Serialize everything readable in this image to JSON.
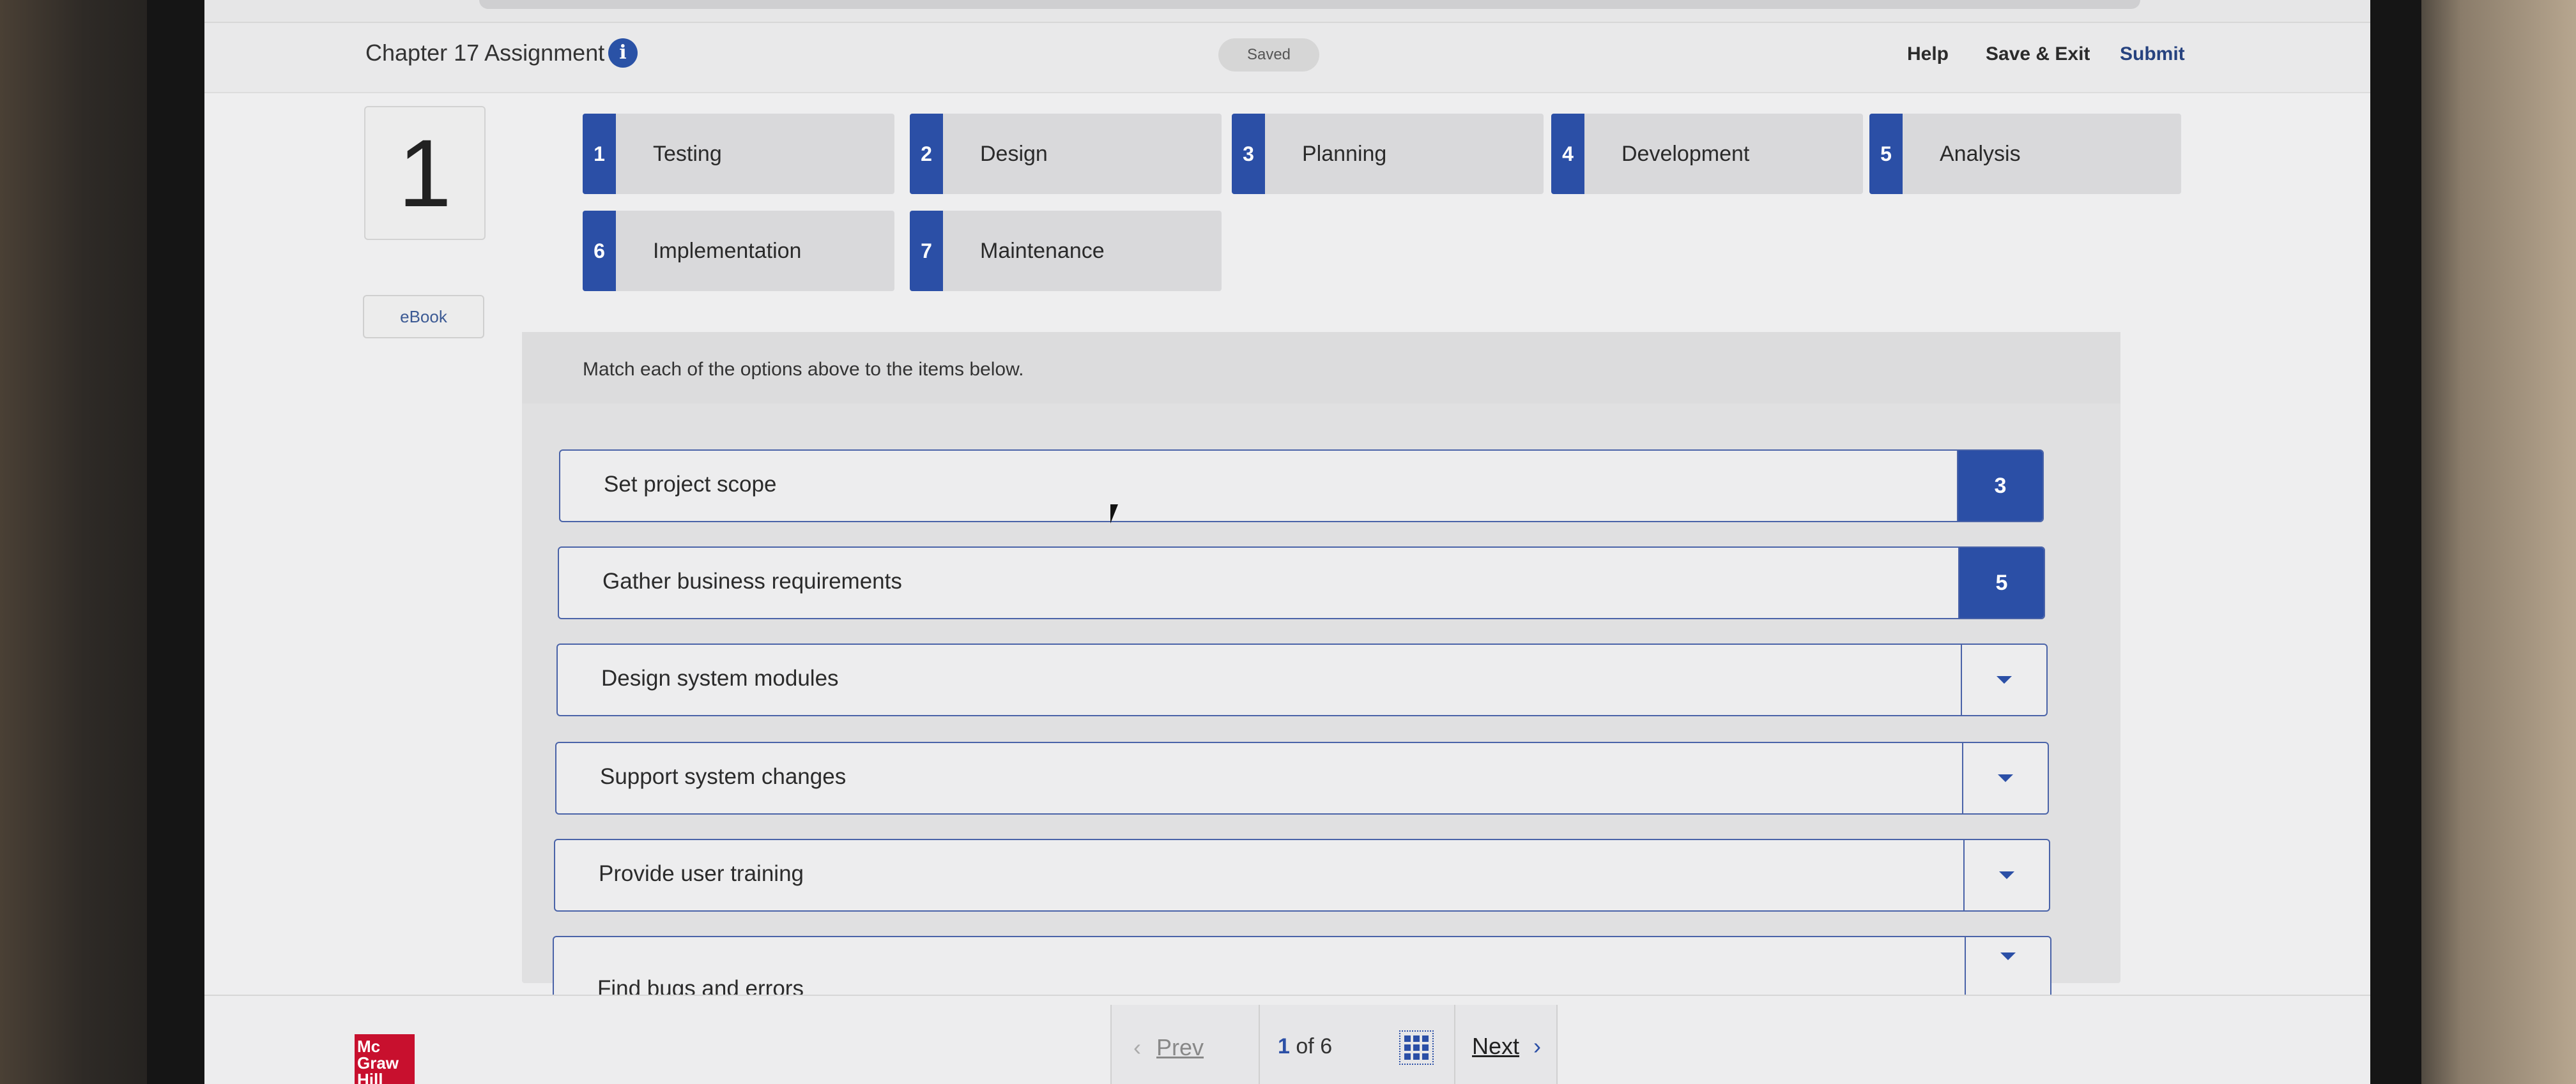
{
  "header": {
    "title": "Chapter 17 Assignment",
    "saved_badge": "Saved",
    "help_label": "Help",
    "save_exit_label": "Save & Exit",
    "submit_label": "Submit",
    "info_icon": "i"
  },
  "question_number": "1",
  "ebook_label": "eBook",
  "options": [
    {
      "num": "1",
      "label": "Testing"
    },
    {
      "num": "2",
      "label": "Design"
    },
    {
      "num": "3",
      "label": "Planning"
    },
    {
      "num": "4",
      "label": "Development"
    },
    {
      "num": "5",
      "label": "Analysis"
    },
    {
      "num": "6",
      "label": "Implementation"
    },
    {
      "num": "7",
      "label": "Maintenance"
    }
  ],
  "instructions": "Match each of the options above to the items below.",
  "items": [
    {
      "text": "Set project scope",
      "answer": "3"
    },
    {
      "text": "Gather business requirements",
      "answer": "5"
    },
    {
      "text": "Design system modules",
      "answer": ""
    },
    {
      "text": "Support system changes",
      "answer": ""
    },
    {
      "text": "Provide user training",
      "answer": ""
    },
    {
      "text": "Find bugs and errors",
      "answer": ""
    }
  ],
  "footer": {
    "logo_text": "Mc Graw Hill",
    "prev_label": "Prev",
    "current_page": "1",
    "of_label": "of",
    "total_pages": "6",
    "next_label": "Next"
  },
  "colors": {
    "accent": "#2b4fa6",
    "logo": "#c8102e"
  }
}
